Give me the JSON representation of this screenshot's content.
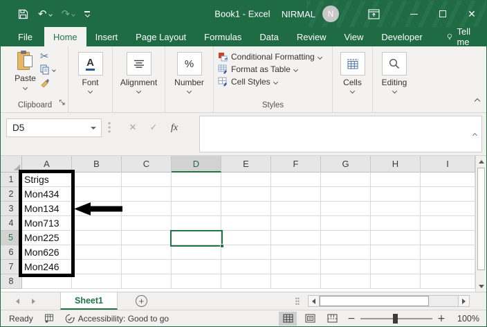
{
  "colors": {
    "brand_green": "#1e6b44",
    "accent_green": "#217346",
    "annotation_black": "#000000"
  },
  "titlebar": {
    "title": "Book1 - Excel",
    "user_name": "NIRMAL",
    "user_initial": "N"
  },
  "tabs": [
    {
      "label": "File",
      "type": "file"
    },
    {
      "label": "Home",
      "type": "active"
    },
    {
      "label": "Insert",
      "type": "normal"
    },
    {
      "label": "Page Layout",
      "type": "normal"
    },
    {
      "label": "Formulas",
      "type": "normal"
    },
    {
      "label": "Data",
      "type": "normal"
    },
    {
      "label": "Review",
      "type": "normal"
    },
    {
      "label": "View",
      "type": "normal"
    },
    {
      "label": "Developer",
      "type": "normal"
    }
  ],
  "tellme_label": "Tell me",
  "ribbon": {
    "paste_label": "Paste",
    "clipboard_label": "Clipboard",
    "font_label": "Font",
    "alignment_label": "Alignment",
    "number_label": "Number",
    "styles_label": "Styles",
    "styles_items": [
      "Conditional Formatting",
      "Format as Table",
      "Cell Styles"
    ],
    "cells_label": "Cells",
    "editing_label": "Editing",
    "font_icon_letter": "A",
    "number_icon_symbol": "%"
  },
  "formula": {
    "name_box": "D5",
    "fx_label": "fx",
    "value": ""
  },
  "grid": {
    "columns": [
      "A",
      "B",
      "C",
      "D",
      "E",
      "F",
      "G",
      "H",
      "I"
    ],
    "row_count": 8,
    "cells": {
      "A1": "Strigs",
      "A2": "Mon434",
      "A3": "Mon134",
      "A4": "Mon713",
      "A5": "Mon225",
      "A6": "Mon626",
      "A7": "Mon246"
    },
    "selected_cell": "D5",
    "selected_column": "D",
    "selected_row": 5,
    "boxed_range": "A1:A7",
    "arrow_points_at_row": 3
  },
  "sheetbar": {
    "tabs": [
      {
        "label": "Sheet1",
        "active": true
      }
    ]
  },
  "statusbar": {
    "mode": "Ready",
    "accessibility": "Accessibility: Good to go",
    "zoom_level": "100%"
  }
}
